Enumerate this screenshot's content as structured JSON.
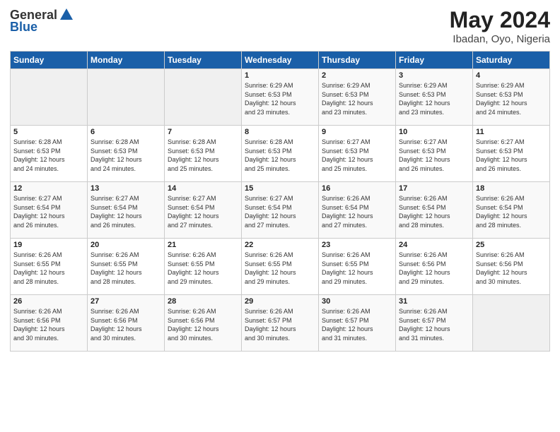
{
  "header": {
    "logo_general": "General",
    "logo_blue": "Blue",
    "title": "May 2024",
    "subtitle": "Ibadan, Oyo, Nigeria"
  },
  "weekdays": [
    "Sunday",
    "Monday",
    "Tuesday",
    "Wednesday",
    "Thursday",
    "Friday",
    "Saturday"
  ],
  "weeks": [
    [
      {
        "day": "",
        "info": ""
      },
      {
        "day": "",
        "info": ""
      },
      {
        "day": "",
        "info": ""
      },
      {
        "day": "1",
        "info": "Sunrise: 6:29 AM\nSunset: 6:53 PM\nDaylight: 12 hours\nand 23 minutes."
      },
      {
        "day": "2",
        "info": "Sunrise: 6:29 AM\nSunset: 6:53 PM\nDaylight: 12 hours\nand 23 minutes."
      },
      {
        "day": "3",
        "info": "Sunrise: 6:29 AM\nSunset: 6:53 PM\nDaylight: 12 hours\nand 23 minutes."
      },
      {
        "day": "4",
        "info": "Sunrise: 6:29 AM\nSunset: 6:53 PM\nDaylight: 12 hours\nand 24 minutes."
      }
    ],
    [
      {
        "day": "5",
        "info": "Sunrise: 6:28 AM\nSunset: 6:53 PM\nDaylight: 12 hours\nand 24 minutes."
      },
      {
        "day": "6",
        "info": "Sunrise: 6:28 AM\nSunset: 6:53 PM\nDaylight: 12 hours\nand 24 minutes."
      },
      {
        "day": "7",
        "info": "Sunrise: 6:28 AM\nSunset: 6:53 PM\nDaylight: 12 hours\nand 25 minutes."
      },
      {
        "day": "8",
        "info": "Sunrise: 6:28 AM\nSunset: 6:53 PM\nDaylight: 12 hours\nand 25 minutes."
      },
      {
        "day": "9",
        "info": "Sunrise: 6:27 AM\nSunset: 6:53 PM\nDaylight: 12 hours\nand 25 minutes."
      },
      {
        "day": "10",
        "info": "Sunrise: 6:27 AM\nSunset: 6:53 PM\nDaylight: 12 hours\nand 26 minutes."
      },
      {
        "day": "11",
        "info": "Sunrise: 6:27 AM\nSunset: 6:53 PM\nDaylight: 12 hours\nand 26 minutes."
      }
    ],
    [
      {
        "day": "12",
        "info": "Sunrise: 6:27 AM\nSunset: 6:54 PM\nDaylight: 12 hours\nand 26 minutes."
      },
      {
        "day": "13",
        "info": "Sunrise: 6:27 AM\nSunset: 6:54 PM\nDaylight: 12 hours\nand 26 minutes."
      },
      {
        "day": "14",
        "info": "Sunrise: 6:27 AM\nSunset: 6:54 PM\nDaylight: 12 hours\nand 27 minutes."
      },
      {
        "day": "15",
        "info": "Sunrise: 6:27 AM\nSunset: 6:54 PM\nDaylight: 12 hours\nand 27 minutes."
      },
      {
        "day": "16",
        "info": "Sunrise: 6:26 AM\nSunset: 6:54 PM\nDaylight: 12 hours\nand 27 minutes."
      },
      {
        "day": "17",
        "info": "Sunrise: 6:26 AM\nSunset: 6:54 PM\nDaylight: 12 hours\nand 28 minutes."
      },
      {
        "day": "18",
        "info": "Sunrise: 6:26 AM\nSunset: 6:54 PM\nDaylight: 12 hours\nand 28 minutes."
      }
    ],
    [
      {
        "day": "19",
        "info": "Sunrise: 6:26 AM\nSunset: 6:55 PM\nDaylight: 12 hours\nand 28 minutes."
      },
      {
        "day": "20",
        "info": "Sunrise: 6:26 AM\nSunset: 6:55 PM\nDaylight: 12 hours\nand 28 minutes."
      },
      {
        "day": "21",
        "info": "Sunrise: 6:26 AM\nSunset: 6:55 PM\nDaylight: 12 hours\nand 29 minutes."
      },
      {
        "day": "22",
        "info": "Sunrise: 6:26 AM\nSunset: 6:55 PM\nDaylight: 12 hours\nand 29 minutes."
      },
      {
        "day": "23",
        "info": "Sunrise: 6:26 AM\nSunset: 6:55 PM\nDaylight: 12 hours\nand 29 minutes."
      },
      {
        "day": "24",
        "info": "Sunrise: 6:26 AM\nSunset: 6:56 PM\nDaylight: 12 hours\nand 29 minutes."
      },
      {
        "day": "25",
        "info": "Sunrise: 6:26 AM\nSunset: 6:56 PM\nDaylight: 12 hours\nand 30 minutes."
      }
    ],
    [
      {
        "day": "26",
        "info": "Sunrise: 6:26 AM\nSunset: 6:56 PM\nDaylight: 12 hours\nand 30 minutes."
      },
      {
        "day": "27",
        "info": "Sunrise: 6:26 AM\nSunset: 6:56 PM\nDaylight: 12 hours\nand 30 minutes."
      },
      {
        "day": "28",
        "info": "Sunrise: 6:26 AM\nSunset: 6:56 PM\nDaylight: 12 hours\nand 30 minutes."
      },
      {
        "day": "29",
        "info": "Sunrise: 6:26 AM\nSunset: 6:57 PM\nDaylight: 12 hours\nand 30 minutes."
      },
      {
        "day": "30",
        "info": "Sunrise: 6:26 AM\nSunset: 6:57 PM\nDaylight: 12 hours\nand 31 minutes."
      },
      {
        "day": "31",
        "info": "Sunrise: 6:26 AM\nSunset: 6:57 PM\nDaylight: 12 hours\nand 31 minutes."
      },
      {
        "day": "",
        "info": ""
      }
    ]
  ]
}
